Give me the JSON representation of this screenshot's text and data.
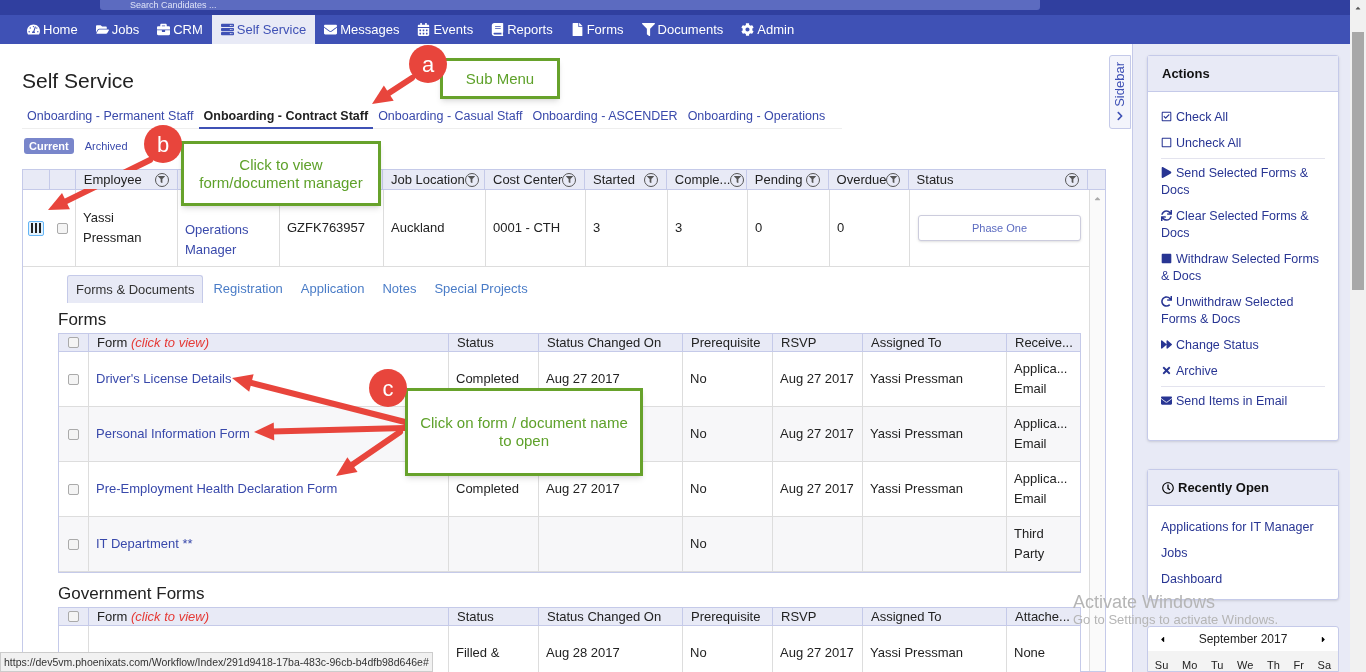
{
  "top_bar": {
    "search": {
      "placeholder": "Search Candidates ..."
    }
  },
  "nav": [
    {
      "label": "Home",
      "selected": false
    },
    {
      "label": "Jobs",
      "selected": false
    },
    {
      "label": "CRM",
      "selected": false
    },
    {
      "label": "Self Service",
      "selected": true
    },
    {
      "label": "Messages",
      "selected": false
    },
    {
      "label": "Events",
      "selected": false
    },
    {
      "label": "Reports",
      "selected": false
    },
    {
      "label": "Forms",
      "selected": false
    },
    {
      "label": "Documents",
      "selected": false
    },
    {
      "label": "Admin",
      "selected": false
    }
  ],
  "page_title": "Self Service",
  "sub_menu": [
    {
      "label": "Onboarding - Permanent Staff",
      "selected": false
    },
    {
      "label": "Onboarding - Contract Staff",
      "selected": true
    },
    {
      "label": "Onboarding - Casual Staff",
      "selected": false
    },
    {
      "label": "Onboarding - ASCENDER",
      "selected": false
    },
    {
      "label": "Onboarding - Operations",
      "selected": false
    }
  ],
  "view_toggle": [
    {
      "label": "Current",
      "selected": true
    },
    {
      "label": "Archived",
      "selected": false
    }
  ],
  "employees": {
    "columns": [
      "Employee",
      null,
      null,
      "Job Location",
      "Cost Center",
      "Started",
      "Comple...",
      "Pending",
      "Overdue",
      "Status"
    ],
    "rows": [
      {
        "expanded": true,
        "checked": false,
        "cells": [
          "Yassi Pressman",
          "Operations Manager",
          "GZFK763957",
          "Auckland",
          "0001 - CTH",
          "3",
          "3",
          "0",
          "0"
        ],
        "status_button": "Phase One"
      }
    ]
  },
  "detail_tabs": [
    {
      "label": "Forms & Documents",
      "selected": true
    },
    {
      "label": "Registration",
      "selected": false
    },
    {
      "label": "Application",
      "selected": false
    },
    {
      "label": "Notes",
      "selected": false
    },
    {
      "label": "Special Projects",
      "selected": false
    }
  ],
  "forms": {
    "title": "Forms",
    "columns": [
      "Form",
      "Status",
      "Status Changed On",
      "Prerequisite",
      "RSVP",
      "Assigned To",
      "Receive..."
    ],
    "form_hint": "(click to view)",
    "all_checked": false,
    "rows": [
      {
        "checked": false,
        "cells": [
          "Driver's License Details",
          "Completed",
          "Aug 27 2017",
          "No",
          "Aug 27 2017",
          "Yassi Pressman",
          "Applica...\nEmail"
        ]
      },
      {
        "checked": false,
        "cells": [
          "Personal Information Form",
          null,
          null,
          "No",
          "Aug 27 2017",
          "Yassi Pressman",
          "Applica...\nEmail"
        ]
      },
      {
        "checked": false,
        "cells": [
          "Pre-Employment Health Declaration Form",
          "Completed",
          "Aug 27 2017",
          "No",
          "Aug 27 2017",
          "Yassi Pressman",
          "Applica...\nEmail"
        ]
      },
      {
        "checked": false,
        "cells": [
          "IT Department **",
          null,
          null,
          "No",
          null,
          null,
          "Third Party"
        ]
      }
    ]
  },
  "government_forms": {
    "title": "Government Forms",
    "columns": [
      "Form",
      "Status",
      "Status Changed On",
      "Prerequisite",
      "RSVP",
      "Assigned To",
      "Attache..."
    ],
    "form_hint": "(click to view)",
    "all_checked": false,
    "rows": [
      {
        "cells": [
          null,
          "Filled &",
          "Aug 28 2017",
          "No",
          "Aug 27 2017",
          "Yassi Pressman",
          "None"
        ]
      }
    ]
  },
  "sidebar_tab": "Sidebar",
  "actions": {
    "title": "Actions",
    "groups": [
      [
        "Check All",
        "Uncheck All"
      ],
      [
        "Send Selected Forms & Docs",
        "Clear Selected Forms & Docs",
        "Withdraw Selected Forms & Docs",
        "Unwithdraw Selected Forms & Docs",
        "Change Status",
        "Archive"
      ],
      [
        "Send Items in Email"
      ]
    ]
  },
  "recently_open": {
    "title": "Recently Open",
    "items": [
      "Applications for IT Manager",
      "Jobs",
      "Dashboard"
    ]
  },
  "calendar": {
    "month": "September 2017",
    "weekdays": [
      "Su",
      "Mo",
      "Tu",
      "We",
      "Th",
      "Fr",
      "Sa"
    ]
  },
  "annotations": [
    {
      "marker": "a",
      "callout": "Sub Menu"
    },
    {
      "marker": "b",
      "callout": "Click to view form/document manager"
    },
    {
      "marker": "c",
      "callout": "Click on form / document name to open"
    }
  ],
  "status_url": "https://dev5vm.phoenixats.com/Workflow/Index/291d9418-17ba-483c-96cb-b4dfb98d646e#",
  "os_notice": {
    "title": "Activate Windows",
    "text": "Go to Settings to activate Windows."
  }
}
